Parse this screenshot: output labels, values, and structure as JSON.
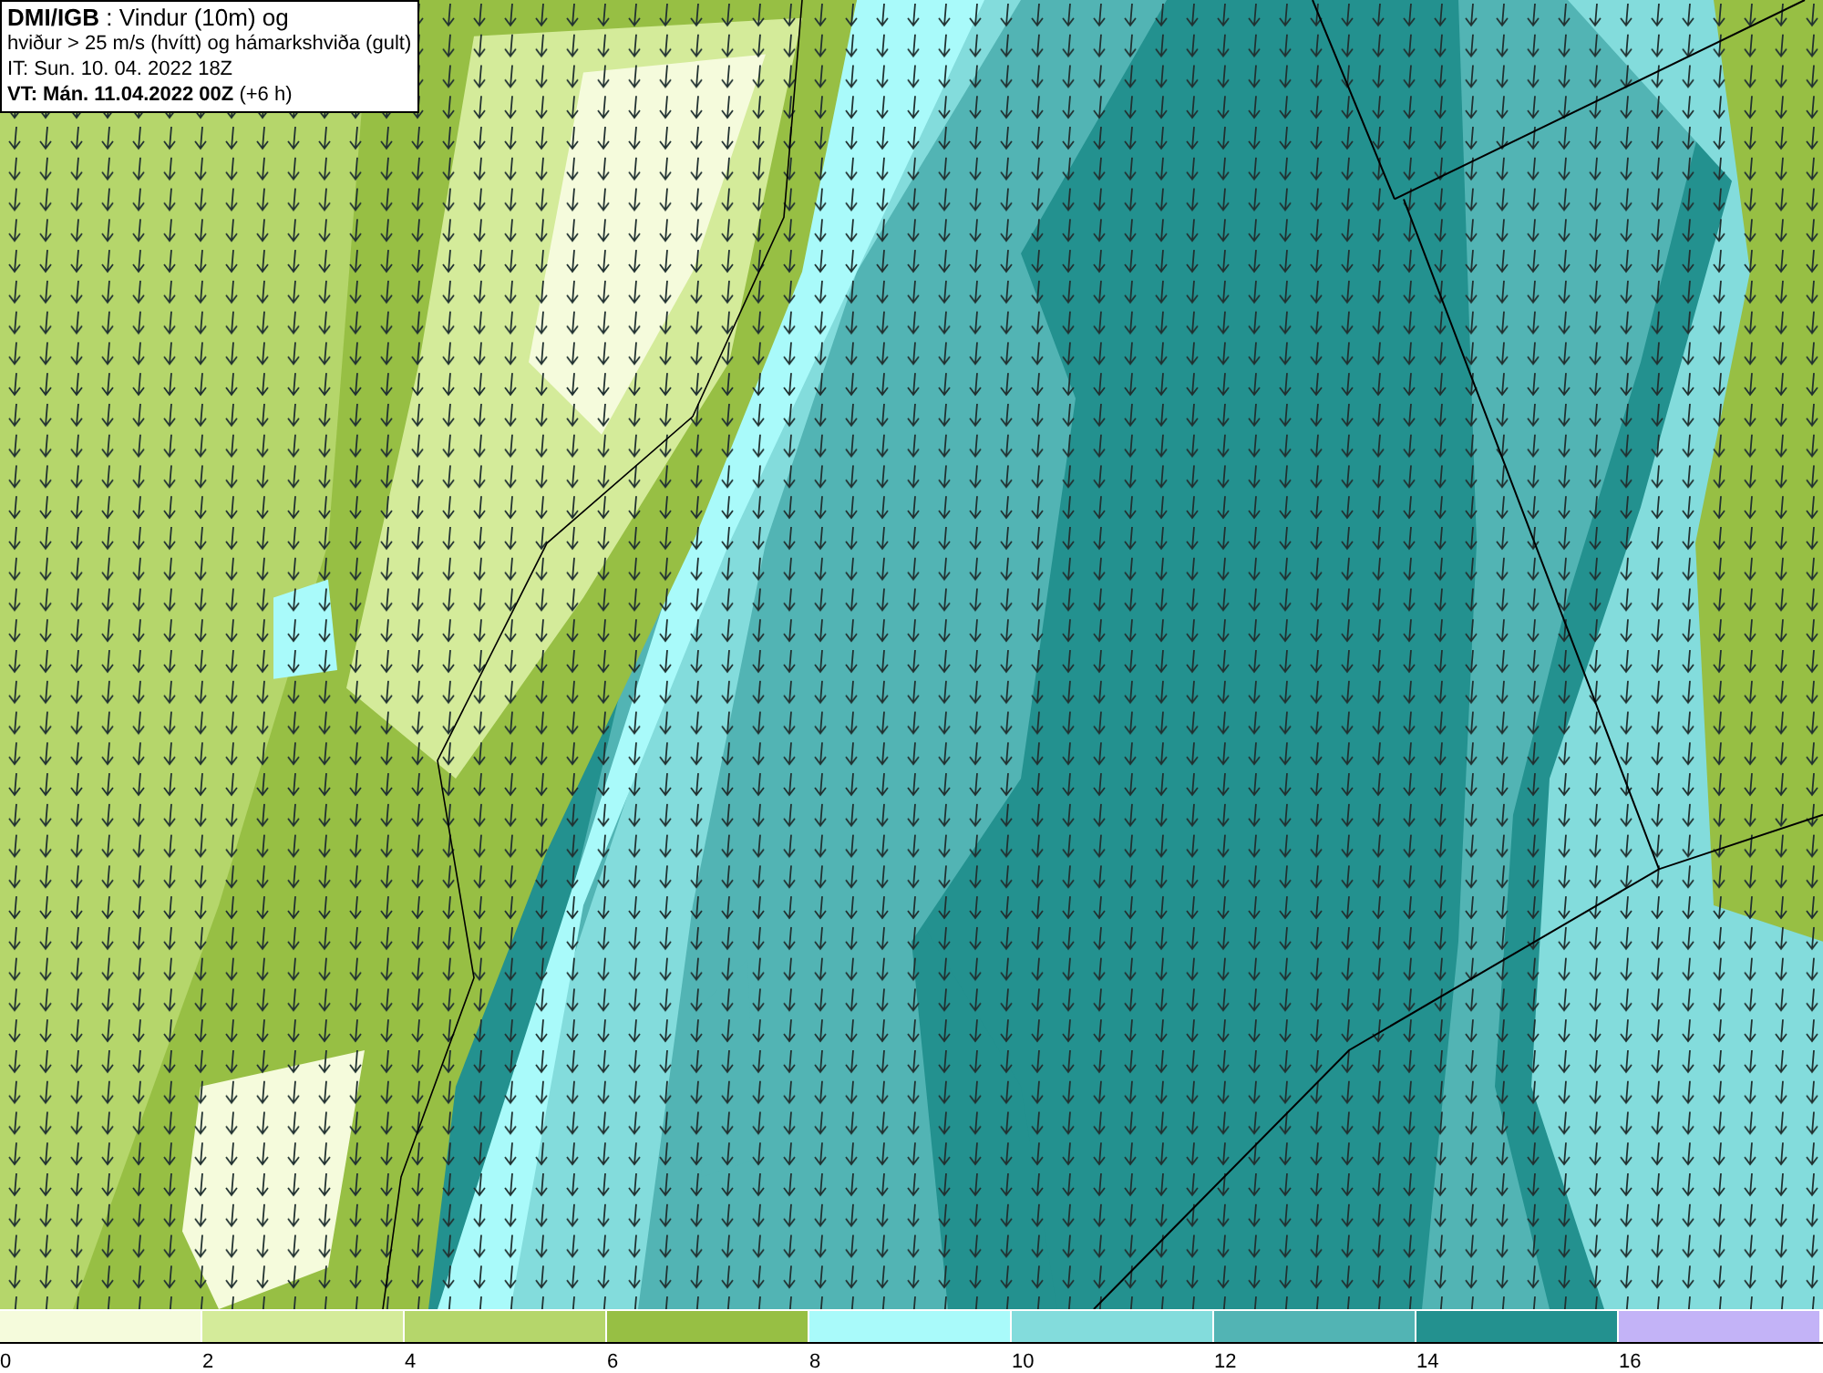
{
  "info_box": {
    "lines": [
      "**DMI/IGB** : Vindur (10m) og",
      "hviður > 25 m/s (hvítt) og hámarkshviða (gult)",
      "IT: Sun. 10. 04. 2022 18Z",
      "**VT: Mán. 11.04.2022 00Z** (+6 h)"
    ]
  },
  "legend": {
    "bins": [
      {
        "label": "0",
        "color": "#f5fbdc"
      },
      {
        "label": "2",
        "color": "#d4eb9a"
      },
      {
        "label": "4",
        "color": "#b5d66b"
      },
      {
        "label": "6",
        "color": "#97bf44"
      },
      {
        "label": "8",
        "color": "#a9fafa"
      },
      {
        "label": "10",
        "color": "#83dcdc"
      },
      {
        "label": "12",
        "color": "#52b4b4"
      },
      {
        "label": "14",
        "color": "#23918f"
      },
      {
        "label": "16",
        "color": "#c3b3f7"
      }
    ]
  }
}
